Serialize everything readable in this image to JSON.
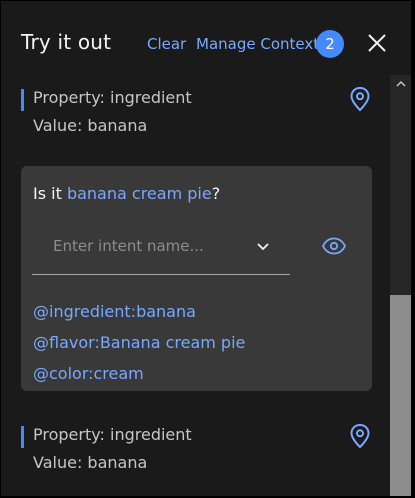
{
  "header": {
    "title": "Try it out",
    "clear_label": "Clear",
    "manage_label": "Manage Context",
    "context_count": "2"
  },
  "properties": [
    {
      "property": "Property: ingredient",
      "value": "Value: banana"
    },
    {
      "property": "Property: ingredient",
      "value": "Value: banana"
    }
  ],
  "card": {
    "question_prefix": "Is it ",
    "question_highlight": "banana cream pie",
    "question_suffix": "?",
    "intent_placeholder": "Enter intent name...",
    "entities": [
      "@ingredient:banana",
      "@flavor:Banana cream pie",
      "@color:cream"
    ]
  },
  "colors": {
    "accent": "#78a9ff",
    "badge": "#4589ff",
    "panel": "#1a1a1a",
    "card": "#393939"
  },
  "icons": [
    "close-icon",
    "location-pin-icon",
    "chevron-down-icon",
    "eye-icon"
  ]
}
